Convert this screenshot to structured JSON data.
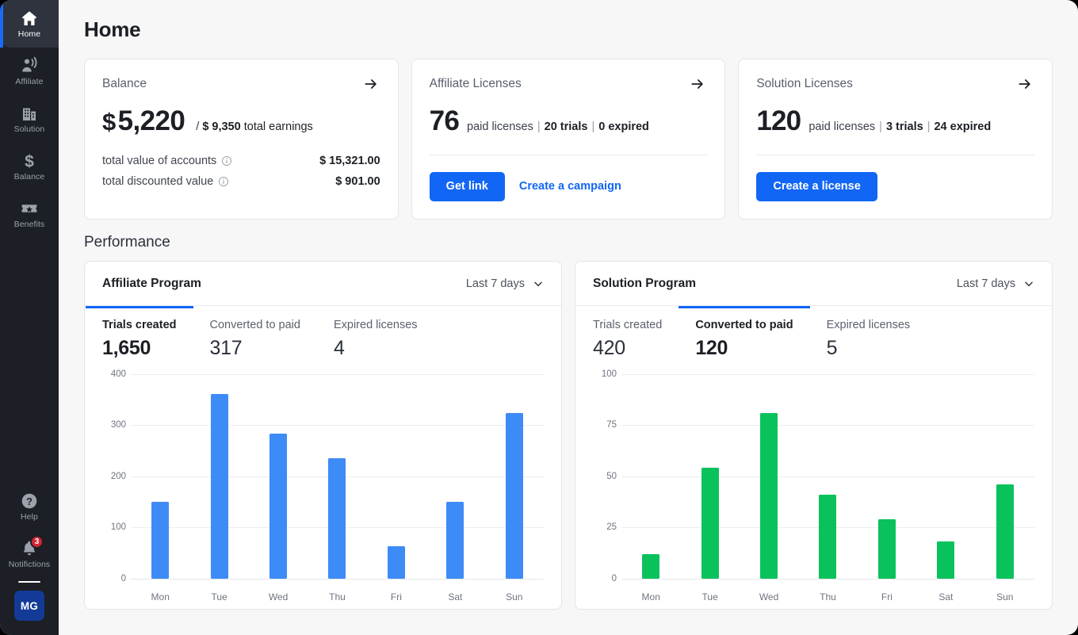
{
  "sidebar": {
    "items": [
      {
        "label": "Home",
        "icon": "home-icon",
        "active": true
      },
      {
        "label": "Affiliate",
        "icon": "affiliate-icon",
        "active": false
      },
      {
        "label": "Solution",
        "icon": "building-icon",
        "active": false
      },
      {
        "label": "Balance",
        "icon": "dollar-icon",
        "active": false
      },
      {
        "label": "Benefits",
        "icon": "ticket-star-icon",
        "active": false
      }
    ],
    "bottom": [
      {
        "label": "Help",
        "icon": "help-icon",
        "badge": ""
      },
      {
        "label": "Notifictions",
        "icon": "bell-icon",
        "badge": "3"
      }
    ],
    "avatar": "MG",
    "accent": "#1a6bf5",
    "badge_color": "#d32535",
    "avatar_color": "#123a96"
  },
  "header": {
    "title": "Home"
  },
  "cards": {
    "balance": {
      "title": "Balance",
      "arrow": "arrow-right-icon",
      "currency": "$",
      "amount": "5,220",
      "sub_prefix": "/",
      "sub_amount": "$ 9,350",
      "sub_label": "total earnings",
      "rows": [
        {
          "key": "total value of accounts",
          "info": "info-icon",
          "value": "$ 15,321.00"
        },
        {
          "key": "total discounted value",
          "info": "info-icon",
          "value": "$ 901.00"
        }
      ]
    },
    "affiliate_licenses": {
      "title": "Affiliate Licenses",
      "arrow": "arrow-right-icon",
      "count": "76",
      "count_label": "paid licenses",
      "trials": "20 trials",
      "expired": "0 expired",
      "primary_button": "Get link",
      "link_button": "Create a campaign"
    },
    "solution_licenses": {
      "title": "Solution Licenses",
      "arrow": "arrow-right-icon",
      "count": "120",
      "count_label": "paid licenses",
      "trials": "3 trials",
      "expired": "24 expired",
      "primary_button": "Create a license"
    }
  },
  "performance": {
    "section_title": "Performance",
    "panels": [
      {
        "title": "Affiliate Program",
        "range": "Last 7 days",
        "chevron": "chevron-down-icon",
        "tabs": [
          {
            "label": "Trials created",
            "value": "1,650",
            "active": true
          },
          {
            "label": "Converted to paid",
            "value": "317",
            "active": false
          },
          {
            "label": "Expired licenses",
            "value": "4",
            "active": false
          }
        ]
      },
      {
        "title": "Solution Program",
        "range": "Last 7 days",
        "chevron": "chevron-down-icon",
        "tabs": [
          {
            "label": "Trials created",
            "value": "420",
            "active": false
          },
          {
            "label": "Converted to paid",
            "value": "120",
            "active": true
          },
          {
            "label": "Expired licenses",
            "value": "5",
            "active": false
          }
        ]
      }
    ]
  },
  "chart_data": [
    {
      "type": "bar",
      "title": "Affiliate Program - Trials created",
      "categories": [
        "Mon",
        "Tue",
        "Wed",
        "Thu",
        "Fri",
        "Sat",
        "Sun"
      ],
      "values": [
        150,
        360,
        283,
        235,
        63,
        150,
        323
      ],
      "yticks": [
        0,
        100,
        200,
        300,
        400
      ],
      "ylim": [
        0,
        400
      ],
      "xlabel": "",
      "ylabel": "",
      "grid": true,
      "color": "#3d8bf7",
      "legend": "none"
    },
    {
      "type": "bar",
      "title": "Solution Program - Converted to paid",
      "categories": [
        "Mon",
        "Tue",
        "Wed",
        "Thu",
        "Fri",
        "Sat",
        "Sun"
      ],
      "values": [
        12,
        54,
        81,
        41,
        29,
        18,
        46
      ],
      "yticks": [
        0,
        25,
        50,
        75,
        100
      ],
      "ylim": [
        0,
        100
      ],
      "xlabel": "",
      "ylabel": "",
      "grid": true,
      "color": "#0ac25c",
      "legend": "none"
    }
  ]
}
